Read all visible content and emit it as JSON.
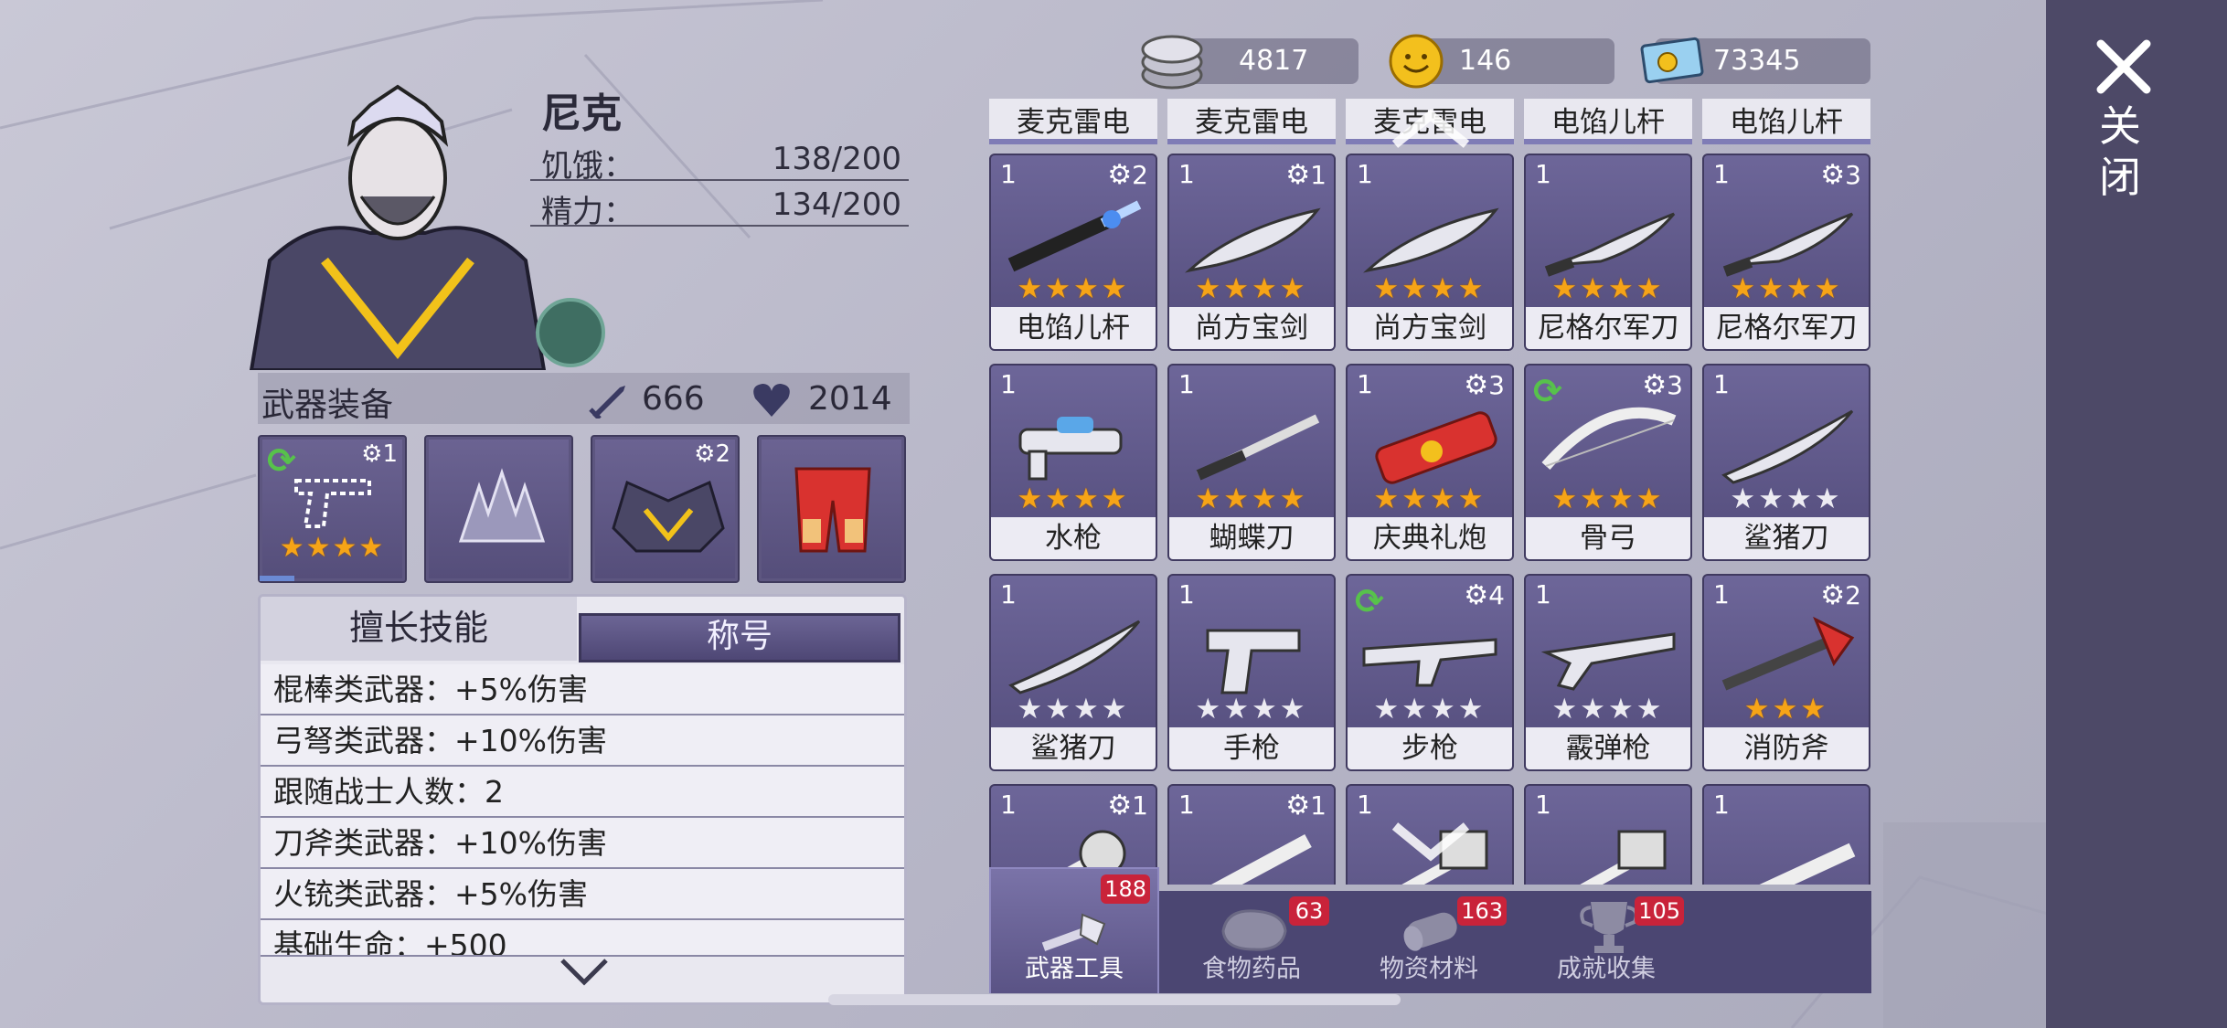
{
  "character": {
    "name": "尼克",
    "stats": [
      {
        "label": "饥饿：",
        "value": "138/200"
      },
      {
        "label": "精力：",
        "value": "134/200"
      }
    ]
  },
  "equipment": {
    "title": "武器装备",
    "attack": "666",
    "health": "2014",
    "slots": [
      {
        "icon": "pistol-icon",
        "refresh": true,
        "level": "1",
        "stars": 4
      },
      {
        "icon": "antler-crown-icon"
      },
      {
        "icon": "armor-icon",
        "level": "2"
      },
      {
        "icon": "red-pants-icon"
      }
    ]
  },
  "skills": {
    "tab_skill": "擅长技能",
    "tab_title": "称号",
    "items": [
      "棍棒类武器：+5%伤害",
      "弓弩类武器：+10%伤害",
      "跟随战士人数：2",
      "刀斧类武器：+10%伤害",
      "火铳类武器：+5%伤害",
      "基础生命：+500"
    ]
  },
  "currency": {
    "silver": "4817",
    "gold": "146",
    "ticket": "73345"
  },
  "top_strip_names": [
    "麦克雷电",
    "麦克雷电",
    "麦克雷电",
    "电馅儿杆",
    "电馅儿杆"
  ],
  "inventory": [
    {
      "qty": "1",
      "level": "2",
      "name": "电馅儿杆",
      "stars": 4,
      "filled": 4,
      "art": "electric-rod"
    },
    {
      "qty": "1",
      "level": "1",
      "name": "尚方宝剑",
      "stars": 4,
      "filled": 4,
      "art": "fish-sword"
    },
    {
      "qty": "1",
      "level": "",
      "name": "尚方宝剑",
      "stars": 4,
      "filled": 4,
      "art": "fish-sword"
    },
    {
      "qty": "1",
      "level": "",
      "name": "尼格尔军刀",
      "stars": 4,
      "filled": 4,
      "art": "kukri"
    },
    {
      "qty": "1",
      "level": "3",
      "name": "尼格尔军刀",
      "stars": 4,
      "filled": 4,
      "art": "kukri"
    },
    {
      "qty": "1",
      "level": "",
      "name": "水枪",
      "stars": 4,
      "filled": 4,
      "art": "water-gun"
    },
    {
      "qty": "1",
      "level": "",
      "name": "蝴蝶刀",
      "stars": 4,
      "filled": 4,
      "art": "butterfly-knife"
    },
    {
      "qty": "1",
      "level": "3",
      "name": "庆典礼炮",
      "stars": 4,
      "filled": 4,
      "art": "firework"
    },
    {
      "qty": "",
      "refresh": true,
      "level": "3",
      "name": "骨弓",
      "stars": 4,
      "filled": 4,
      "art": "bone-bow"
    },
    {
      "qty": "1",
      "level": "",
      "name": "鲨猪刀",
      "stars": 4,
      "filled": 0,
      "art": "shark-blade"
    },
    {
      "qty": "1",
      "level": "",
      "name": "鲨猪刀",
      "stars": 4,
      "filled": 0,
      "art": "shark-blade"
    },
    {
      "qty": "1",
      "level": "",
      "name": "手枪",
      "stars": 4,
      "filled": 0,
      "art": "pistol"
    },
    {
      "qty": "",
      "refresh": true,
      "level": "4",
      "name": "步枪",
      "stars": 4,
      "filled": 0,
      "art": "rifle"
    },
    {
      "qty": "1",
      "level": "",
      "name": "霰弹枪",
      "stars": 4,
      "filled": 0,
      "art": "shotgun"
    },
    {
      "qty": "1",
      "level": "2",
      "name": "消防斧",
      "stars": 3,
      "filled": 3,
      "art": "fire-axe"
    },
    {
      "qty": "1",
      "level": "1",
      "name": "",
      "stars": 0,
      "filled": 0,
      "art": "mace"
    },
    {
      "qty": "1",
      "level": "1",
      "name": "",
      "stars": 0,
      "filled": 0,
      "art": "spiked-club"
    },
    {
      "qty": "1",
      "level": "",
      "name": "",
      "stars": 0,
      "filled": 0,
      "art": "hammer"
    },
    {
      "qty": "1",
      "level": "",
      "name": "",
      "stars": 0,
      "filled": 0,
      "art": "hammer"
    },
    {
      "qty": "1",
      "level": "",
      "name": "",
      "stars": 0,
      "filled": 0,
      "art": "pipe"
    }
  ],
  "bottom_tabs": [
    {
      "label": "武器工具",
      "badge": "188",
      "icon": "axe-icon",
      "active": true
    },
    {
      "label": "食物药品",
      "badge": "63",
      "icon": "meat-icon"
    },
    {
      "label": "物资材料",
      "badge": "163",
      "icon": "log-icon"
    },
    {
      "label": "成就收集",
      "badge": "105",
      "icon": "trophy-icon"
    }
  ],
  "close_label": "关闭",
  "colors": {
    "accent": "#5d5680",
    "badge": "#c9233a",
    "star": "#f6a417",
    "refresh": "#57c24b"
  }
}
